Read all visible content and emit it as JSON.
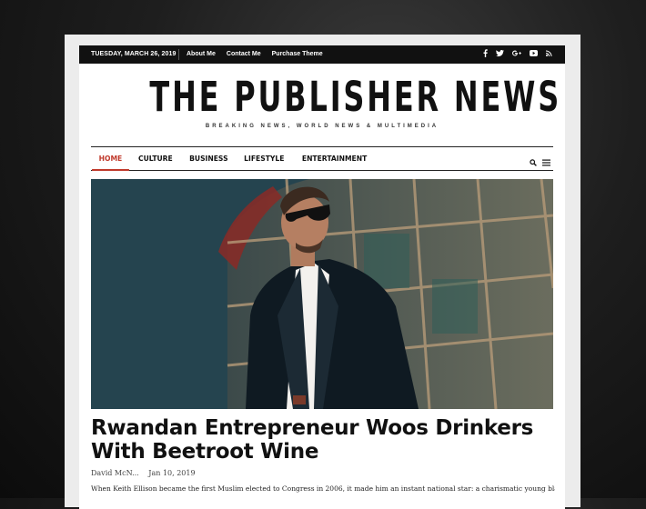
{
  "topbar": {
    "date": "TUESDAY, MARCH 26, 2019",
    "links": [
      "About Me",
      "Contact Me",
      "Purchase Theme"
    ],
    "social_icons": [
      "facebook-icon",
      "twitter-icon",
      "google-plus-icon",
      "youtube-icon",
      "rss-icon"
    ]
  },
  "site": {
    "title": "THE PUBLISHER NEWS",
    "tagline": "BREAKING NEWS, WORLD NEWS & MULTIMEDIA"
  },
  "nav": {
    "items": [
      "HOME",
      "CULTURE",
      "BUSINESS",
      "LIFESTYLE",
      "ENTERTAINMENT"
    ],
    "active_item": "HOME",
    "tools": [
      "search-icon",
      "menu-icon"
    ]
  },
  "article": {
    "title": "Rwandan Entrepreneur Woos Drinkers With Beetroot Wine",
    "author": "David McN...",
    "date": "Jan 10, 2019",
    "excerpt": "When Keith Ellison became the first Muslim elected to Congress in 2006, it made him an instant national star: a charismatic young black",
    "image": "photo of a man in sunglasses and dark suit in front of a glass building"
  },
  "colors": {
    "accent": "#c0392b",
    "topbar_bg": "#111111",
    "page_bg": "#ffffff"
  }
}
